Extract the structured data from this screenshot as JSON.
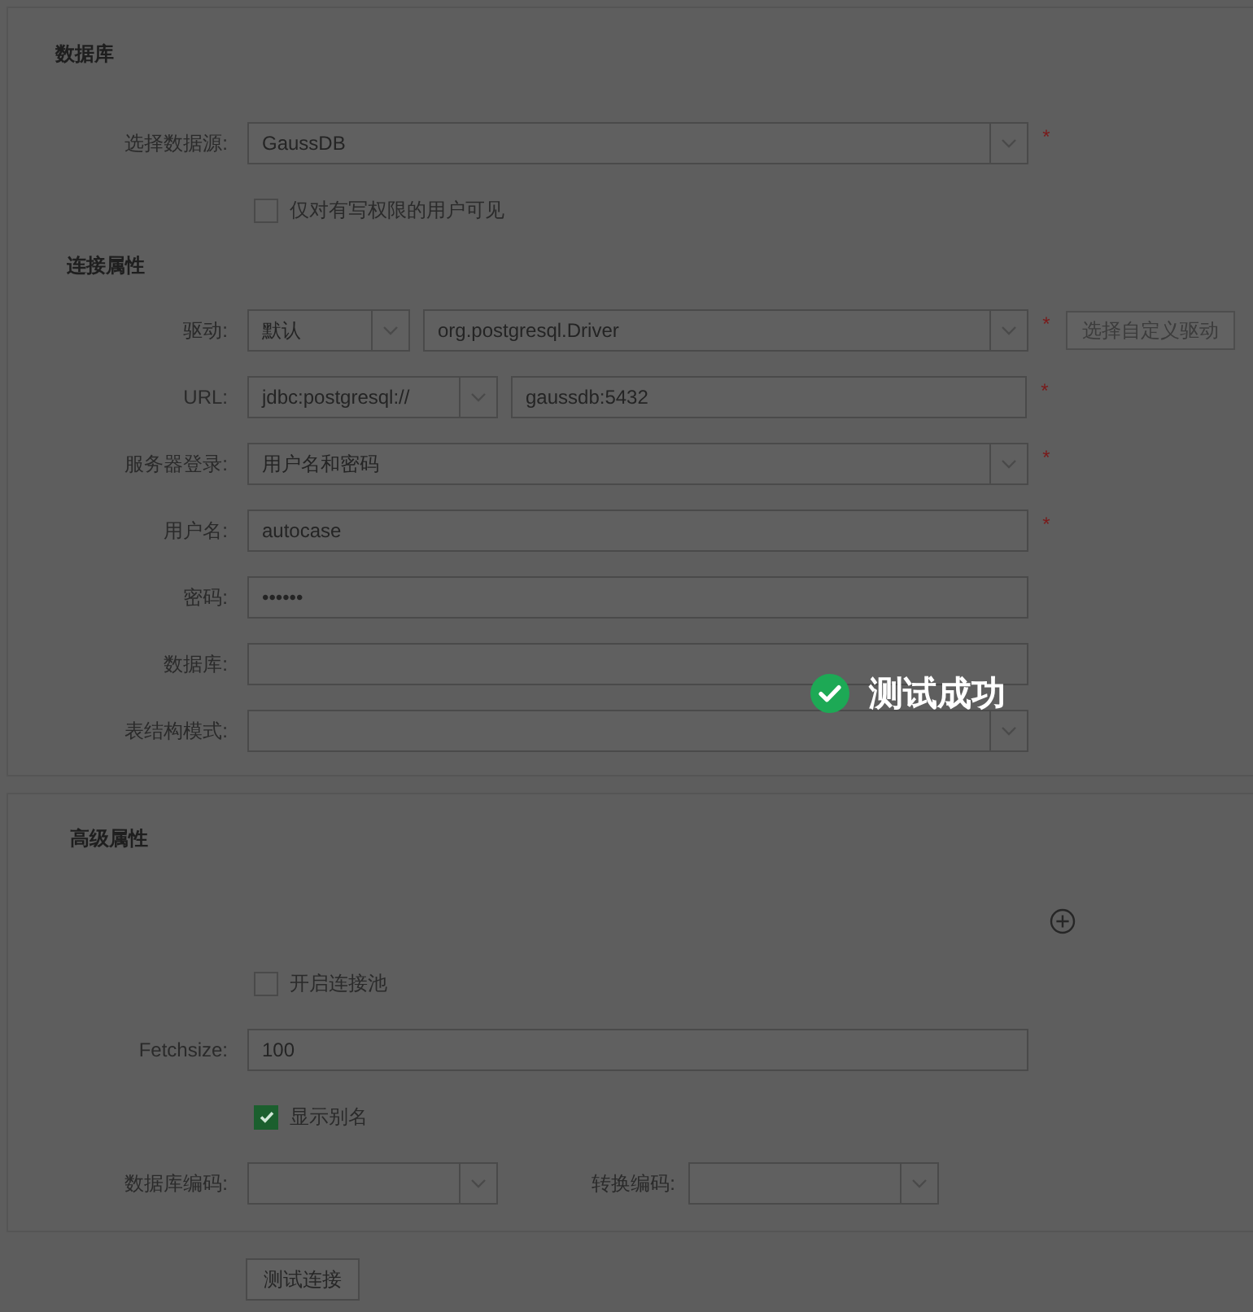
{
  "database": {
    "title": "数据库",
    "datasource": {
      "label": "选择数据源:",
      "value": "GaussDB",
      "required_mark": "*"
    },
    "write_only": {
      "label": "仅对有写权限的用户可见",
      "checked": false
    }
  },
  "connection": {
    "title": "连接属性",
    "rows": [
      {
        "label": "驱动:",
        "controls": [
          {
            "kind": "short-select",
            "value": "默认"
          },
          {
            "kind": "select",
            "value": "org.postgresql.Driver"
          }
        ],
        "required_mark": "*",
        "button": {
          "label": "选择自定义驱动",
          "disabled": true
        }
      },
      {
        "label": "URL:",
        "controls": [
          {
            "kind": "mid-select",
            "value": "jdbc:postgresql://"
          },
          {
            "kind": "input",
            "value": "gaussdb:5432"
          }
        ],
        "required_mark": "*"
      },
      {
        "label": "服务器登录:",
        "controls": [
          {
            "kind": "select",
            "value": "用户名和密码"
          }
        ],
        "required_mark": "*"
      },
      {
        "label": "用户名:",
        "controls": [
          {
            "kind": "input",
            "value": "autocase"
          }
        ],
        "required_mark": "*"
      },
      {
        "label": "密码:",
        "controls": [
          {
            "kind": "password",
            "value": "••••••"
          }
        ]
      },
      {
        "label": "数据库:",
        "controls": [
          {
            "kind": "input"
          }
        ]
      },
      {
        "label": "表结构模式:",
        "controls": [
          {
            "kind": "select"
          }
        ]
      }
    ]
  },
  "advanced": {
    "title": "高级属性",
    "pool": {
      "label": "开启连接池",
      "checked": false
    },
    "fetchsize": {
      "label": "Fetchsize:",
      "value": "100"
    },
    "alias": {
      "label": "显示别名",
      "checked": true
    },
    "db_encoding": {
      "label": "数据库编码:"
    },
    "convert_encoding": {
      "label": "转换编码:"
    }
  },
  "test_button": {
    "label": "测试连接"
  },
  "toast": {
    "text": "测试成功"
  }
}
